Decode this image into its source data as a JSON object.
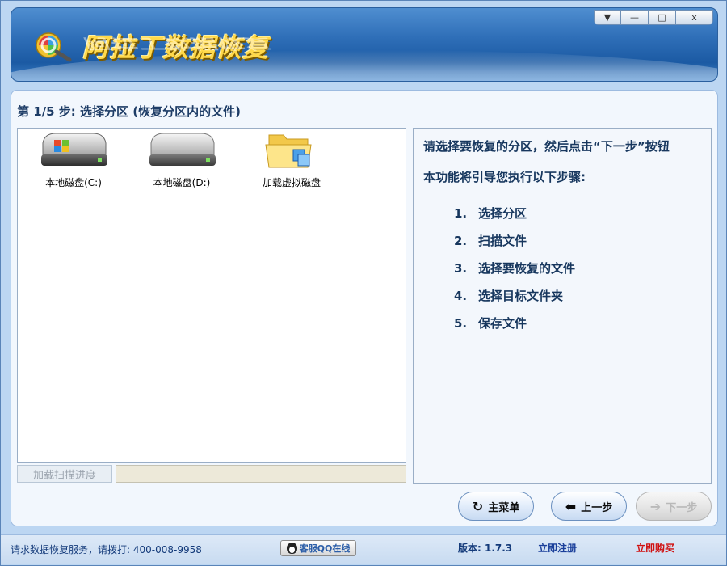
{
  "window": {
    "title": "阿拉丁数据恢复",
    "controls": [
      "▼",
      "—",
      "□",
      "x"
    ]
  },
  "step": {
    "title": "第 1/5 步: 选择分区 (恢复分区内的文件)"
  },
  "drives": [
    {
      "label": "本地磁盘(C:)",
      "icon": "windows-hdd-icon"
    },
    {
      "label": "本地磁盘(D:)",
      "icon": "hdd-icon"
    },
    {
      "label": "加载虚拟磁盘",
      "icon": "virtual-disk-folder-icon"
    }
  ],
  "scan_progress_button": "加载扫描进度",
  "info": {
    "instruction": "请选择要恢复的分区，然后点击“下一步”按钮",
    "intro": "本功能将引导您执行以下步骤:",
    "steps": [
      {
        "num": "1.",
        "text": "选择分区"
      },
      {
        "num": "2.",
        "text": "扫描文件"
      },
      {
        "num": "3.",
        "text": "选择要恢复的文件"
      },
      {
        "num": "4.",
        "text": "选择目标文件夹"
      },
      {
        "num": "5.",
        "text": "保存文件"
      }
    ]
  },
  "nav": {
    "main_menu": "主菜单",
    "prev": "上一步",
    "next": "下一步"
  },
  "status": {
    "service": "请求数据恢复服务，请拨打: 400-008-9958",
    "qq": "客服QQ在线",
    "version": "版本: 1.7.3",
    "register": "立即注册",
    "buy": "立即购买"
  },
  "colors": {
    "banner": "#2f6fb8",
    "title_text": "#ffd94a",
    "buy_link": "#d01010"
  }
}
